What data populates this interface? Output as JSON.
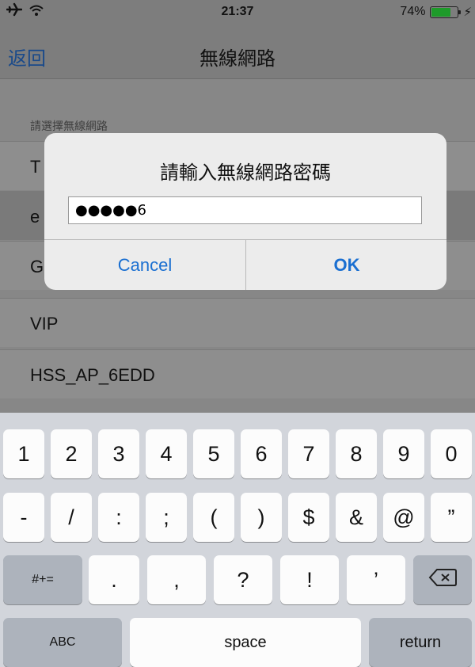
{
  "status_bar": {
    "time": "21:37",
    "battery_percent": "74%",
    "battery_level": 0.74,
    "icons": [
      "airplane-icon",
      "wifi-icon",
      "battery-icon",
      "charging-icon"
    ]
  },
  "nav": {
    "back_label": "返回",
    "title": "無線網路"
  },
  "list": {
    "section_header": "請選擇無線網路",
    "networks": [
      {
        "name": "T",
        "selected": false
      },
      {
        "name": "e",
        "selected": true
      },
      {
        "name": "G",
        "selected": false
      },
      {
        "name": "VIP",
        "selected": false
      },
      {
        "name": "HSS_AP_6EDD",
        "selected": false
      }
    ]
  },
  "alert": {
    "title": "請輸入無線網路密碼",
    "password_value": "●●●●●6",
    "cancel_label": "Cancel",
    "ok_label": "OK"
  },
  "keyboard": {
    "row1": [
      "1",
      "2",
      "3",
      "4",
      "5",
      "6",
      "7",
      "8",
      "9",
      "0"
    ],
    "row2": [
      "-",
      "/",
      ":",
      ";",
      "(",
      ")",
      "$",
      "&",
      "@",
      "”"
    ],
    "row3_mode": "#+=",
    "row3": [
      ".",
      ",",
      "?",
      "!",
      "’"
    ],
    "abc_label": "ABC",
    "space_label": "space",
    "return_label": "return",
    "backspace_icon": "backspace-icon"
  },
  "colors": {
    "accent_blue": "#1a6fd1",
    "battery_green": "#1e9b2a"
  }
}
